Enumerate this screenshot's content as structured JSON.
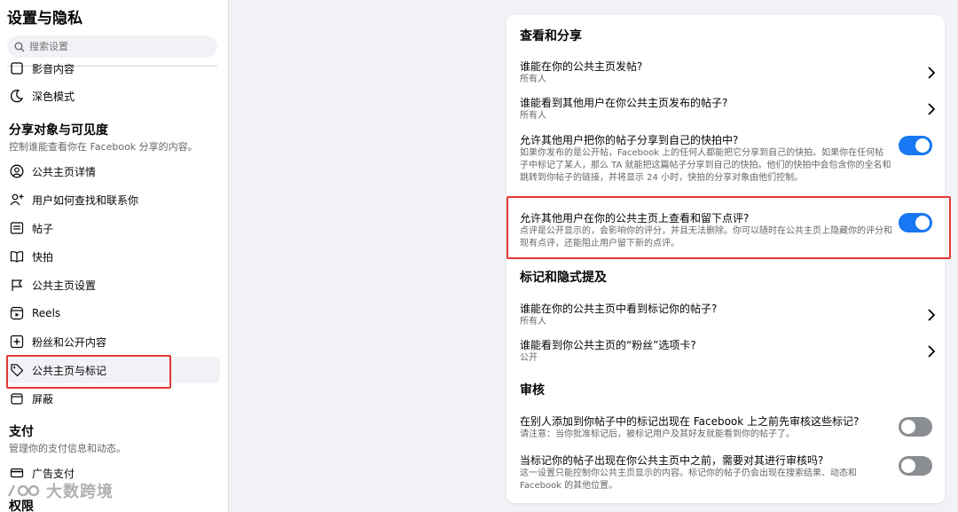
{
  "sidebar": {
    "title": "设置与隐私",
    "search_placeholder": "搜索设置",
    "partial_item": "影音内容",
    "dark_mode": "深色模式",
    "sharing": {
      "title": "分享对象与可见度",
      "desc": "控制谁能查看你在 Facebook 分享的内容。",
      "items": [
        {
          "label": "公共主页详情",
          "icon": "person-circle-icon"
        },
        {
          "label": "用户如何查找和联系你",
          "icon": "person-add-icon"
        },
        {
          "label": "帖子",
          "icon": "post-icon"
        },
        {
          "label": "快拍",
          "icon": "book-icon"
        },
        {
          "label": "公共主页设置",
          "icon": "flag-icon"
        },
        {
          "label": "Reels",
          "icon": "reels-icon"
        },
        {
          "label": "粉丝和公开内容",
          "icon": "plus-square-icon"
        },
        {
          "label": "公共主页与标记",
          "icon": "tag-icon"
        },
        {
          "label": "屏蔽",
          "icon": "block-icon"
        }
      ]
    },
    "payments": {
      "title": "支付",
      "desc": "管理你的支付信息和动态。",
      "item": "广告支付"
    },
    "permissions_title": "权限"
  },
  "watermark": "大数跨境",
  "main": {
    "view_share": {
      "title": "查看和分享",
      "rows": [
        {
          "title": "谁能在你的公共主页发帖?",
          "sub": "所有人"
        },
        {
          "title": "谁能看到其他用户在你公共主页发布的帖子?",
          "sub": "所有人"
        },
        {
          "title": "允许其他用户把你的帖子分享到自己的快拍中?",
          "sub": "如果你发布的是公开帖，Facebook 上的任何人都能把它分享到自己的快拍。如果你在任何帖子中标记了某人，那么 TA 就能把这篇帖子分享到自己的快拍。他们的快拍中会包含你的全名和跳转到你帖子的链接，并将显示 24 小时，快拍的分享对象由他们控制。",
          "toggle": "on"
        },
        {
          "title": "允许其他用户在你的公共主页上查看和留下点评?",
          "sub": "点评是公开显示的，会影响你的评分，并且无法删除。你可以随时在公共主页上隐藏你的评分和现有点评，还能阻止用户留下新的点评。",
          "toggle": "on"
        }
      ]
    },
    "tagging": {
      "title": "标记和隐式提及",
      "rows": [
        {
          "title": "谁能在你的公共主页中看到标记你的帖子?",
          "sub": "所有人"
        },
        {
          "title": "谁能看到你公共主页的“粉丝”选项卡?",
          "sub": "公开"
        }
      ]
    },
    "review": {
      "title": "审核",
      "rows": [
        {
          "title": "在别人添加到你帖子中的标记出现在 Facebook 上之前先审核这些标记?",
          "sub": "请注意：当你批准标记后，被标记用户及其好友就能看到你的帖子了。",
          "toggle": "off"
        },
        {
          "title": "当标记你的帖子出现在你公共主页中之前，需要对其进行审核吗?",
          "sub": "这一设置只能控制你公共主页显示的内容。标记你的帖子仍会出现在搜索结果、动态和 Facebook 的其他位置。",
          "toggle": "off"
        }
      ]
    }
  },
  "colors": {
    "accent": "#1877f2",
    "highlight": "#e53935",
    "toggle_off": "#8a8d91"
  }
}
